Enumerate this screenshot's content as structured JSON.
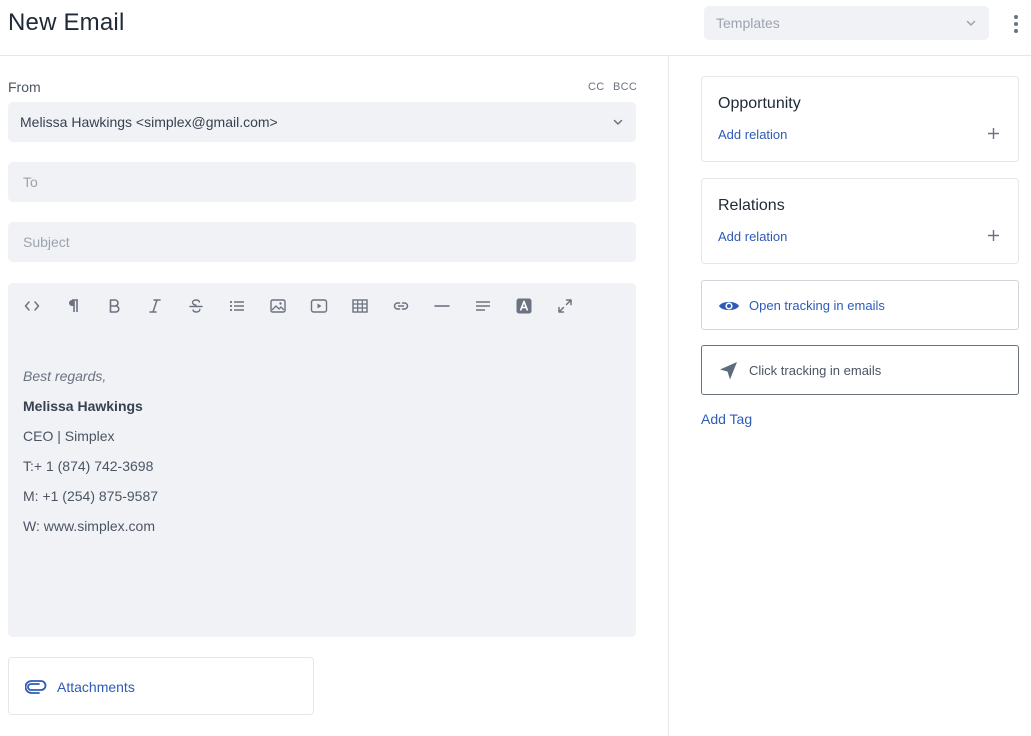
{
  "header": {
    "title": "New Email",
    "templates_placeholder": "Templates"
  },
  "compose": {
    "from_label": "From",
    "cc_label": "CC",
    "bcc_label": "BCC",
    "from_value": "Melissa Hawkings <simplex@gmail.com>",
    "to_placeholder": "To",
    "subject_placeholder": "Subject"
  },
  "editor": {
    "toolbar": [
      "code-view",
      "paragraph",
      "bold",
      "italic",
      "strikethrough",
      "bullet-list",
      "image",
      "video",
      "table",
      "link",
      "horizontal-rule",
      "align",
      "font-color",
      "fullscreen"
    ],
    "signature": {
      "greeting": "Best regards,",
      "name": "Melissa Hawkings",
      "role": "CEO | Simplex",
      "phone_t": "T:+ 1 (874) 742-3698",
      "phone_m": "M: +1 (254) 875-9587",
      "website": "W: www.simplex.com"
    }
  },
  "attachments": {
    "label": "Attachments"
  },
  "sidebar": {
    "opportunity": {
      "title": "Opportunity",
      "link": "Add relation"
    },
    "relations": {
      "title": "Relations",
      "link": "Add relation"
    },
    "open_tracking": {
      "label": "Open tracking in emails",
      "active": true
    },
    "click_tracking": {
      "label": "Click tracking in emails",
      "active": false
    },
    "add_tag": "Add Tag"
  },
  "colors": {
    "accent": "#2f5bb7",
    "field_bg": "#f1f2f6",
    "muted_icon": "#6b7280"
  }
}
